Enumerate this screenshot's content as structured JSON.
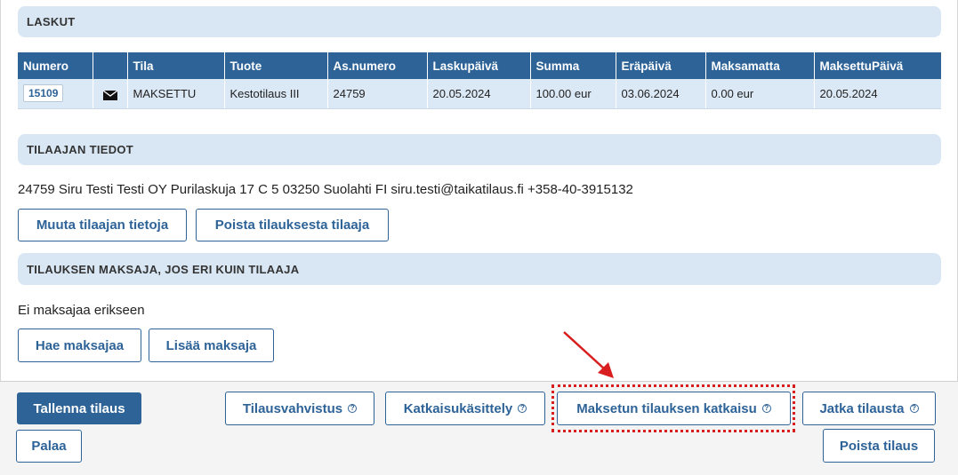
{
  "invoices": {
    "header": "LASKUT",
    "columns": [
      "Numero",
      "",
      "Tila",
      "Tuote",
      "As.numero",
      "Laskupäivä",
      "Summa",
      "Eräpäivä",
      "Maksamatta",
      "MaksettuPäivä"
    ],
    "rows": [
      {
        "numero": "15109",
        "icon": "envelope-icon",
        "tila": "MAKSETTU",
        "tuote": "Kestotilaus III",
        "asnumero": "24759",
        "laskupaiva": "20.05.2024",
        "summa": "100.00 eur",
        "erapaiva": "03.06.2024",
        "maksamatta": "0.00 eur",
        "maksettupaiva": "20.05.2024"
      }
    ]
  },
  "orderer": {
    "header": "TILAAJAN TIEDOT",
    "info": "24759 Siru Testi Testi OY Purilaskuja 17 C 5 03250 Suolahti FI siru.testi@taikatilaus.fi +358-40-3915132",
    "edit_button": "Muuta tilaajan tietoja",
    "remove_button": "Poista tilauksesta tilaaja"
  },
  "payer": {
    "header": "TILAUKSEN MAKSAJA, JOS ERI KUIN TILAAJA",
    "info": "Ei maksajaa erikseen",
    "search_button": "Hae maksajaa",
    "add_button": "Lisää maksaja"
  },
  "footer": {
    "save_button": "Tallenna tilaus",
    "back_button": "Palaa",
    "confirmation_button": "Tilausvahvistus",
    "termination_button": "Katkaisukäsittely",
    "paid_termination_button": "Maksetun tilauksen katkaisu",
    "continue_button": "Jatka tilausta",
    "delete_button": "Poista tilaus",
    "help_glyph": "?"
  },
  "colors": {
    "accent": "#2e6398",
    "section_bg": "#d9e7f4",
    "annotation": "#d81e1e"
  }
}
